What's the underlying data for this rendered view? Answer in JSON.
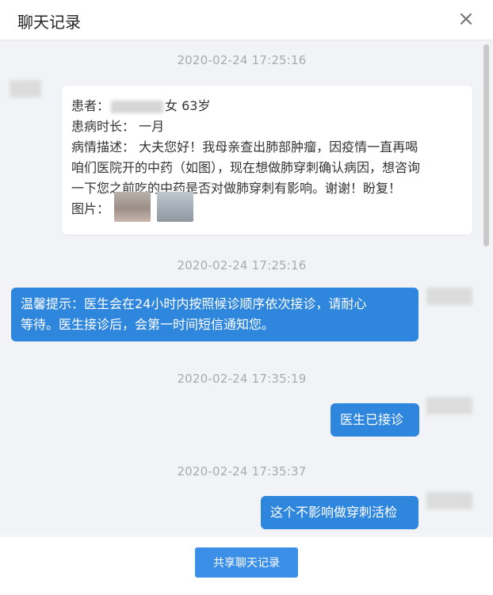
{
  "header": {
    "title": "聊天记录",
    "close_icon": "×"
  },
  "messages": {
    "ts1": "2020-02-24  17:25:16",
    "patient_card": {
      "line1_prefix": "患者：",
      "line1_suffix": "女  63岁",
      "line2": "患病时长：   一月",
      "line3": "病情描述：  大夫您好！我母亲查出肺部肿瘤，因疫情一直再喝",
      "line4": "咱们医院开的中药（如图），现在想做肺穿刺确认病因，想咨询",
      "line5": "一下您之前吃的中药是否对做肺穿刺有影响。谢谢！盼复！",
      "line6": "图片："
    },
    "ts2": "2020-02-24  17:25:16",
    "tip_line1": "温馨提示：医生会在24小时内按照候诊顺序依次接诊，请耐心",
    "tip_line2": "等待。医生接诊后，会第一时间短信通知您。",
    "ts3": "2020-02-24  17:35:19",
    "accepted": "医生已接诊",
    "ts4": "2020-02-24  17:35:37",
    "reply": "这个不影响做穿刺活检"
  },
  "footer": {
    "share_label": "共享聊天记录"
  },
  "colors": {
    "bubble": "#2f86dd",
    "button": "#3b8fe6",
    "chat_bg": "#f1f3f6"
  }
}
